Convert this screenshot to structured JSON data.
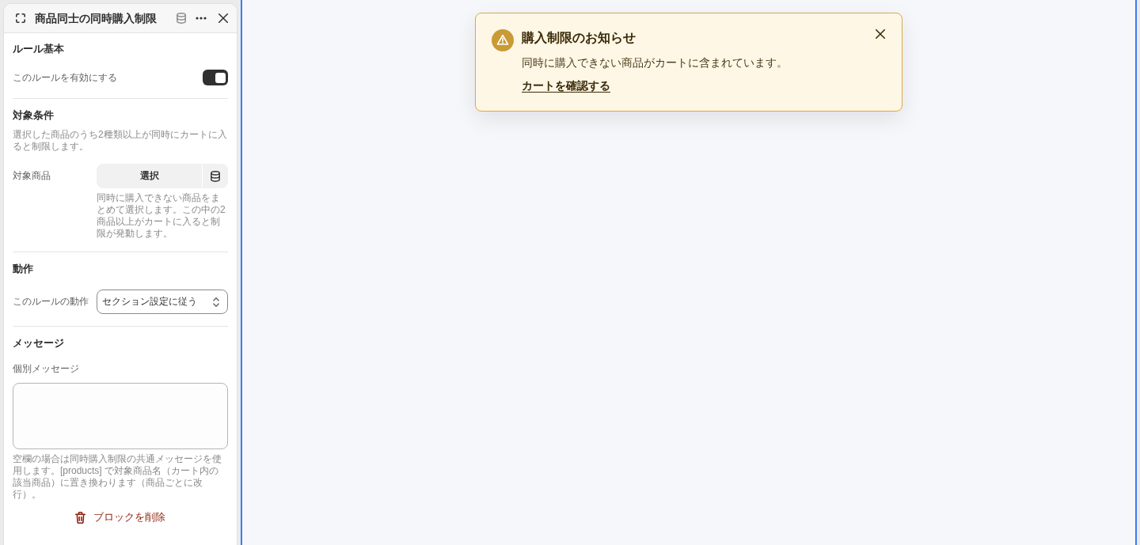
{
  "panel": {
    "title": "商品同士の同時購入制限"
  },
  "sections": [
    {
      "heading": "ルール基本",
      "rows": [
        {
          "kind": "toggle",
          "label": "このルールを有効にする",
          "on": true
        }
      ]
    },
    {
      "heading": "対象条件",
      "description": "選択した商品のうち2種類以上が同時にカートに入ると制限します。",
      "rows": [
        {
          "kind": "picker",
          "label": "対象商品",
          "button": "選択",
          "help": "同時に購入できない商品をまとめて選択します。この中の2商品以上がカートに入ると制限が発動します。"
        }
      ]
    },
    {
      "heading": "動作",
      "rows": [
        {
          "kind": "select",
          "label": "このルールの動作",
          "value": "セクション設定に従う"
        }
      ]
    },
    {
      "heading": "メッセージ",
      "rows": [
        {
          "kind": "textarea",
          "label": "個別メッセージ",
          "help": "空欄の場合は同時購入制限の共通メッセージを使用します。[products] で対象商品名（カート内の該当商品）に置き換わります（商品ごとに改行）。"
        }
      ]
    }
  ],
  "delete_button": "ブロックを削除",
  "notice": {
    "title": "購入制限のお知らせ",
    "message": "同時に購入できない商品がカートに含まれています。",
    "link": "カートを確認する"
  }
}
